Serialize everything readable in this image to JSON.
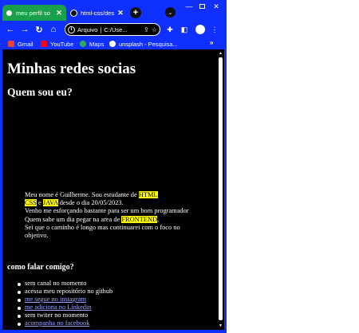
{
  "browser": {
    "tabs": [
      {
        "title": "meu perfil so",
        "close": "✕",
        "favicon": "globe-icon",
        "active": true
      },
      {
        "title": "html-css/des",
        "close": "✕",
        "favicon": "github-icon",
        "active": false
      }
    ],
    "new_tab": "+",
    "tab_search": "⌄",
    "window_controls": {
      "minimize": "—",
      "close": "✕"
    },
    "nav": {
      "back": "←",
      "forward": "→",
      "reload": "↻",
      "home": "⌂"
    },
    "address": {
      "info": "i",
      "security_label": "Arquivo",
      "separator": "|",
      "url": "C:/Use...",
      "share_icon": "⇪",
      "star_icon": "☆"
    },
    "toolbar_icons": {
      "extensions": "✚",
      "side_panel": "◧",
      "menu": "⋮"
    },
    "bookmarks": [
      {
        "label": "Gmail",
        "icon": "gmail-icon",
        "color": "#ea4335"
      },
      {
        "label": "YouTube",
        "icon": "youtube-icon",
        "color": "#ff0000"
      },
      {
        "label": "Maps",
        "icon": "maps-icon",
        "color": "#34a853"
      },
      {
        "label": "unsplash - Pesquisa...",
        "icon": "google-icon",
        "color": "#ffffff"
      }
    ],
    "bookmarks_more": "»",
    "colors": {
      "frame": "#1030ff",
      "active_tab": "#1aa04a",
      "page_bg": "#000000",
      "highlight": "#ffff00",
      "link": "#9fa5ff"
    }
  },
  "page": {
    "title": "Minhas redes socias",
    "about_heading": "Quem sou eu?",
    "bio": {
      "l1_pre": "Meu nome é Guilherme. Sou estudante de ",
      "html": "HTML",
      "l2_css": "CSS",
      "l2_mid": " e ",
      "l2_java": "JAVA",
      "l2_post": " desde o dia 20/05/2023.",
      "l3": "Venho me esforçando bastante para ser um bom programador",
      "l4_pre": "Quem sabe um dia pegar na area de ",
      "frontend": "FRONTEND",
      "l4_post": ".",
      "l5": "Sei que o caminho é longo mas continuarei com o foco no",
      "l6": "objetivo."
    },
    "contact_heading": "como falar comigo?",
    "contacts": [
      {
        "text": "sem canal no momento",
        "link": false
      },
      {
        "text": "acessa meu repositório no github",
        "link": false
      },
      {
        "text": "me segue no instagram",
        "link": true
      },
      {
        "text": "me adiciona no Linkedin",
        "link": true
      },
      {
        "text": "sem twiter no momento",
        "link": false
      },
      {
        "text": "acompanha no facebook",
        "link": true
      }
    ]
  }
}
